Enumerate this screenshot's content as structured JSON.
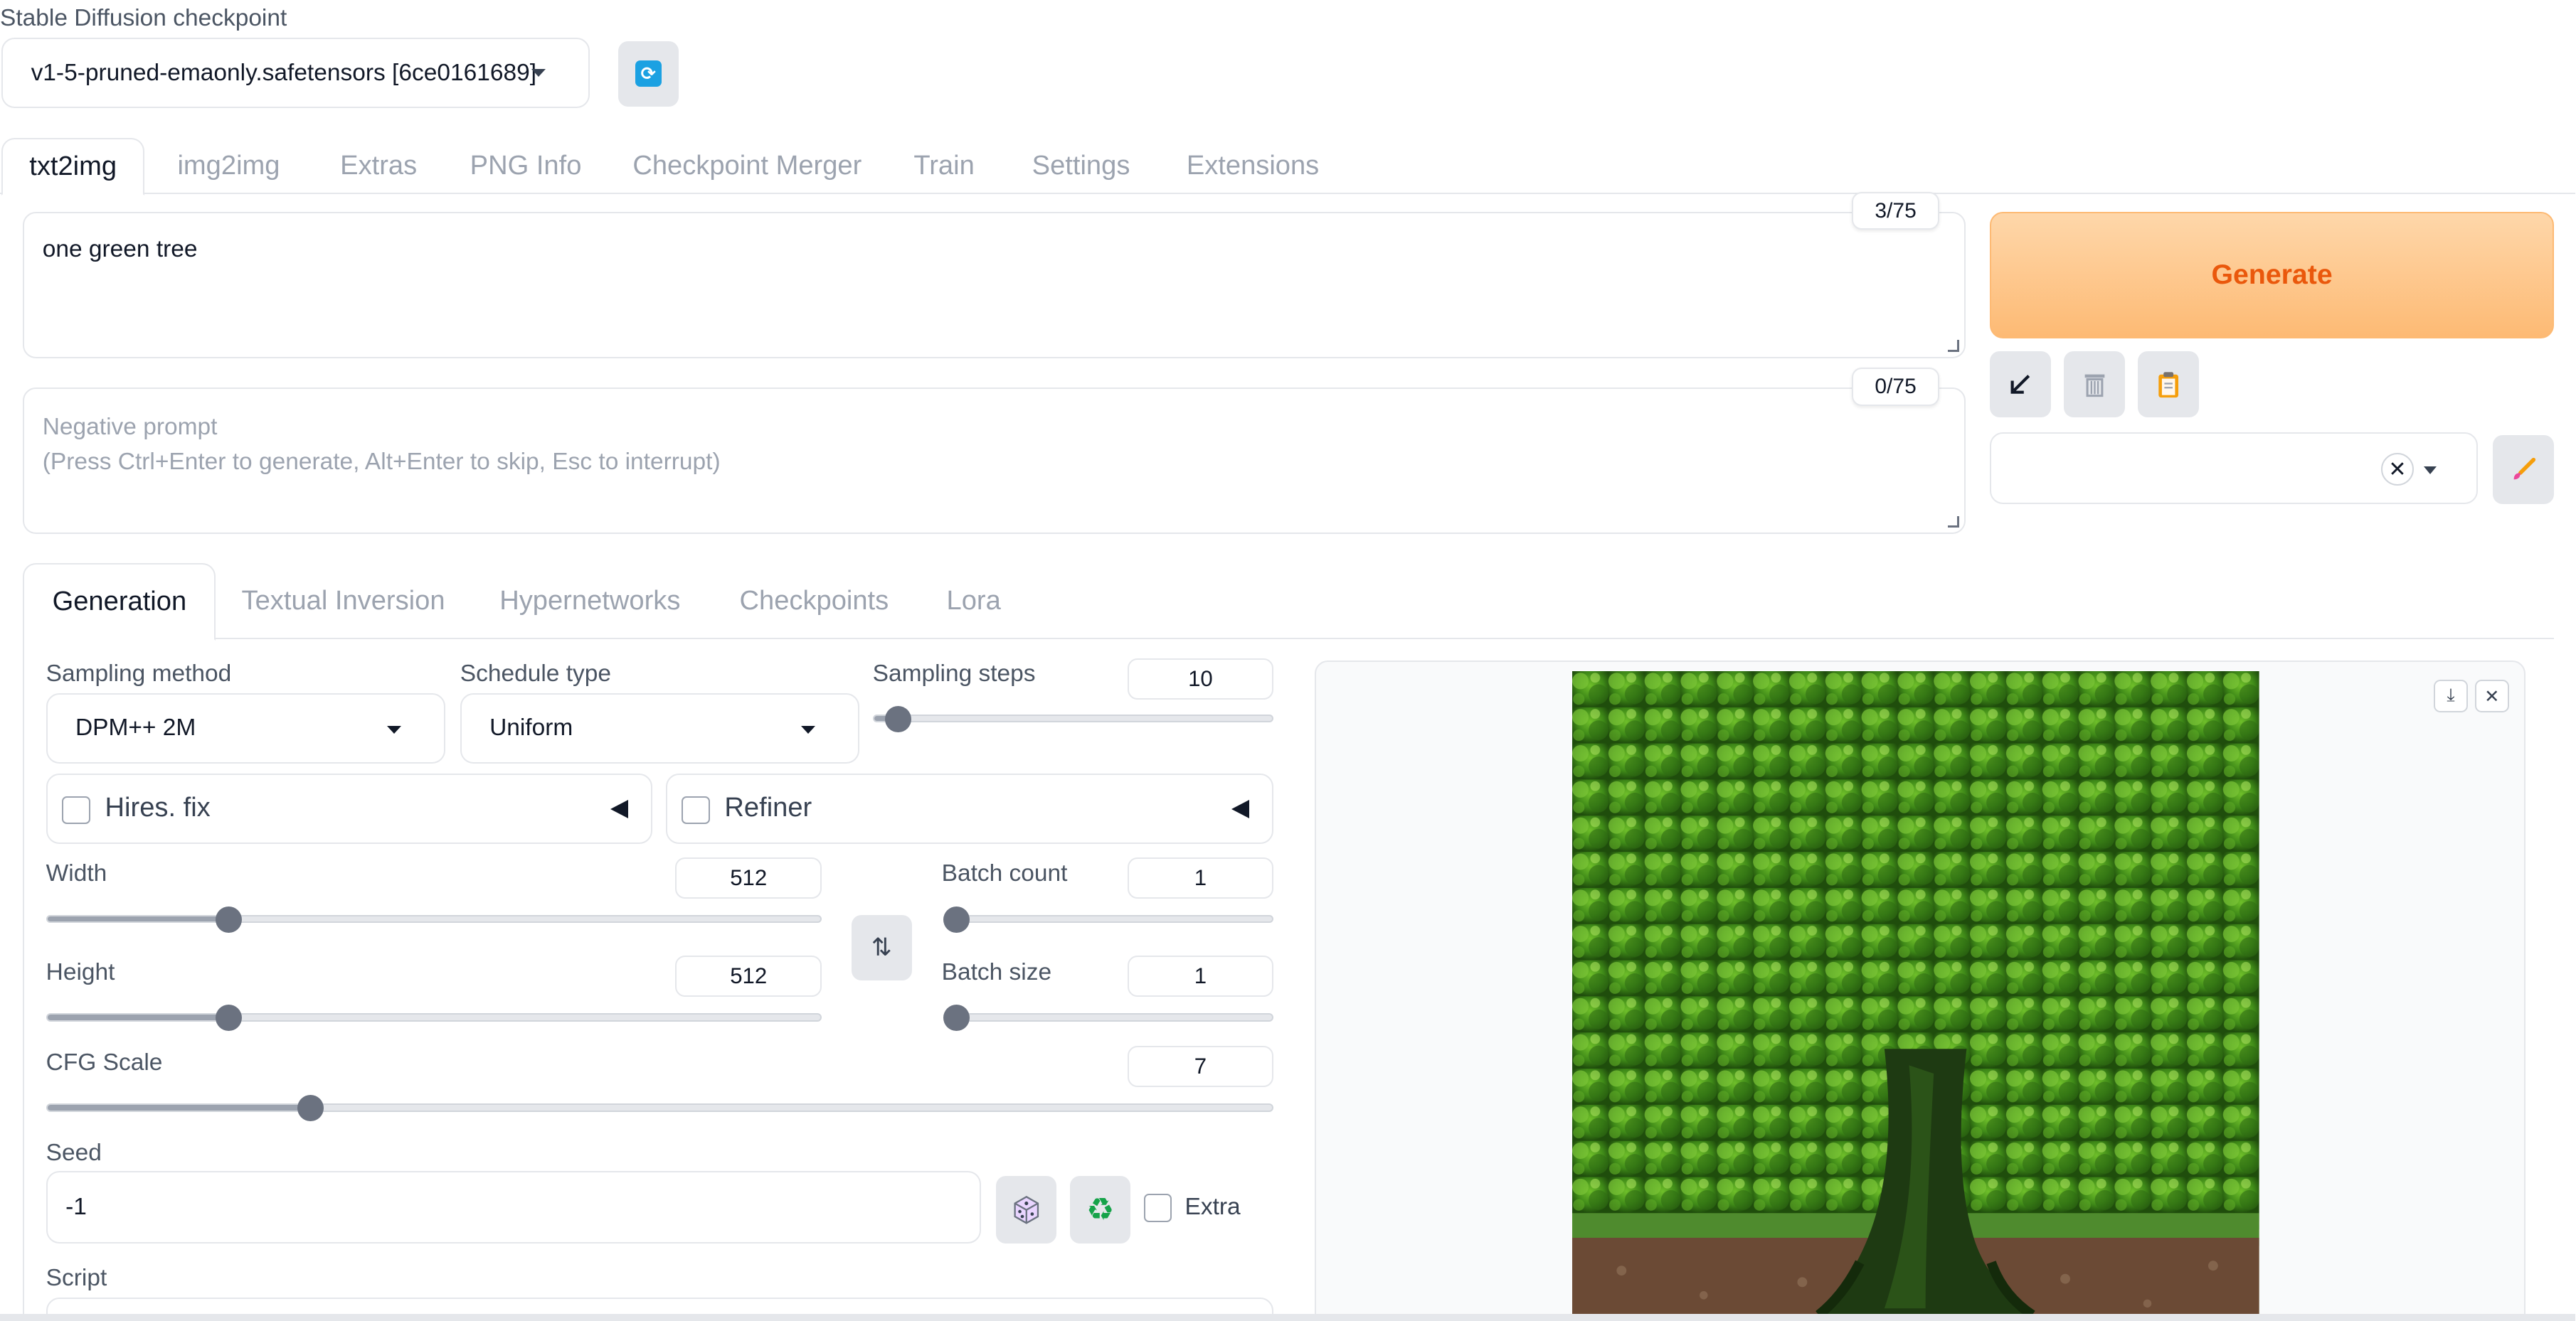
{
  "checkpoint": {
    "label": "Stable Diffusion checkpoint",
    "value": "v1-5-pruned-emaonly.safetensors [6ce0161689]"
  },
  "main_tabs": [
    {
      "label": "txt2img"
    },
    {
      "label": "img2img"
    },
    {
      "label": "Extras"
    },
    {
      "label": "PNG Info"
    },
    {
      "label": "Checkpoint Merger"
    },
    {
      "label": "Train"
    },
    {
      "label": "Settings"
    },
    {
      "label": "Extensions"
    }
  ],
  "prompt": {
    "value": "one green tree",
    "token_count": "3/75"
  },
  "negative_prompt": {
    "placeholder_line1": "Negative prompt",
    "placeholder_line2": "(Press Ctrl+Enter to generate, Alt+Enter to skip, Esc to interrupt)",
    "token_count": "0/75"
  },
  "generate": {
    "label": "Generate"
  },
  "sub_tabs": [
    {
      "label": "Generation"
    },
    {
      "label": "Textual Inversion"
    },
    {
      "label": "Hypernetworks"
    },
    {
      "label": "Checkpoints"
    },
    {
      "label": "Lora"
    }
  ],
  "sampling_method": {
    "label": "Sampling method",
    "value": "DPM++ 2M"
  },
  "schedule_type": {
    "label": "Schedule type",
    "value": "Uniform"
  },
  "sampling_steps": {
    "label": "Sampling steps",
    "value": "10",
    "fraction": 0.06
  },
  "hires_fix": {
    "label": "Hires. fix",
    "checked": false
  },
  "refiner": {
    "label": "Refiner",
    "checked": false
  },
  "width": {
    "label": "Width",
    "value": "512",
    "fraction": 0.235
  },
  "height": {
    "label": "Height",
    "value": "512",
    "fraction": 0.235
  },
  "batch_count": {
    "label": "Batch count",
    "value": "1",
    "fraction": 0.0
  },
  "batch_size": {
    "label": "Batch size",
    "value": "1",
    "fraction": 0.0
  },
  "cfg_scale": {
    "label": "CFG Scale",
    "value": "7",
    "fraction": 0.215
  },
  "seed": {
    "label": "Seed",
    "value": "-1",
    "extra_label": "Extra"
  },
  "script": {
    "label": "Script"
  },
  "colors": {
    "generate_text": "#ea580c",
    "refresh_icon": "#1ba1e2",
    "recycle_icon": "#16a34a"
  },
  "icons": {
    "refresh": "refresh-icon",
    "arrow": "arrow-down-left-icon",
    "trash": "trash-icon",
    "clipboard": "clipboard-icon",
    "brush": "brush-icon",
    "swap": "swap-icon",
    "dice": "dice-icon",
    "recycle": "recycle-icon",
    "download": "download-icon",
    "close": "close-icon"
  }
}
